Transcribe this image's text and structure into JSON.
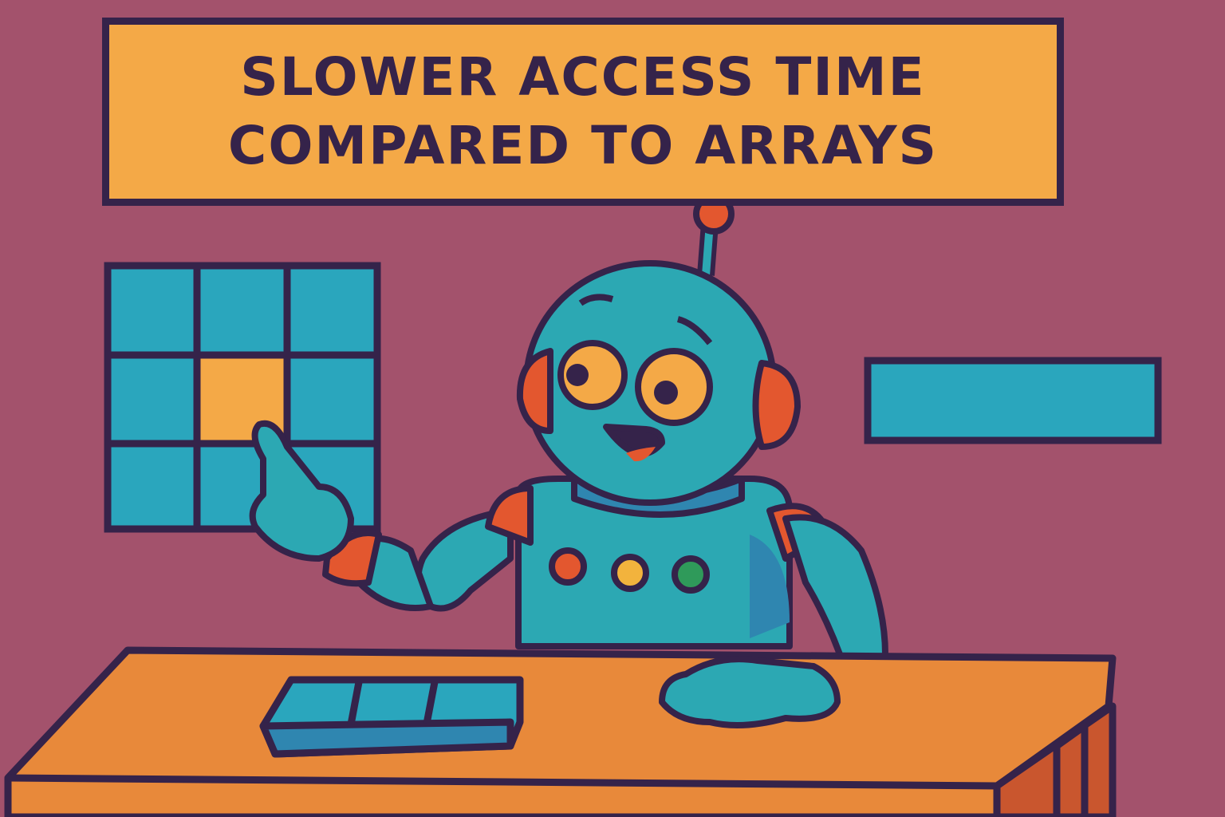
{
  "banner": {
    "line1": "SLOWER ACCESS TIME",
    "line2": "COMPARED TO ARRAYS"
  },
  "colors": {
    "background": "#a3526c",
    "banner": "#f4a947",
    "outline": "#35234a",
    "robot_body": "#2ca8b3",
    "robot_accent": "#e3572f",
    "desk": "#e8893a",
    "grid_cell": "#2aa6bd",
    "grid_highlight": "#f4a947"
  },
  "grid": {
    "rows": 3,
    "cols": 3,
    "highlighted_cell": "row 2, col 2"
  },
  "robot": {
    "chest_lights": [
      "#e3572f",
      "#f2b33d",
      "#2f9a5a"
    ]
  }
}
